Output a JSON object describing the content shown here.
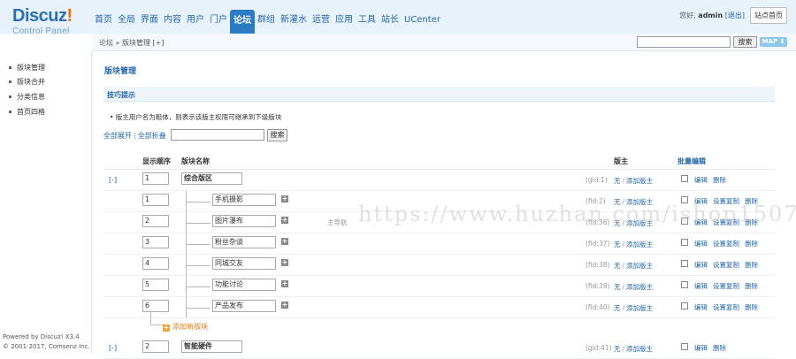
{
  "header": {
    "logo_title": "Discuz",
    "logo_bang": "!",
    "logo_sub": "Control Panel",
    "nav": [
      "首页",
      "全局",
      "界面",
      "内容",
      "用户",
      "门户",
      "论坛",
      "群组",
      "新灌水",
      "运营",
      "应用",
      "工具",
      "站长",
      "UCenter"
    ],
    "active_nav": "论坛",
    "greeting": "您好, ",
    "username": "admin",
    "logout": "[退出]",
    "site_home": "站点首页"
  },
  "subbar": {
    "breadcrumb": "论坛 » 版块管理  [+]",
    "search_button": "搜索",
    "map_button": "MAP ⬇"
  },
  "sidebar": {
    "items": [
      "版块管理",
      "版块合并",
      "分类信息",
      "首页四格"
    ],
    "powered_line1": "Powered by Discuz! X3.4",
    "powered_line2": "© 2001-2017, Comsenz Inc."
  },
  "main": {
    "page_title": "版块管理",
    "tips_title": "技巧提示",
    "tip_text": "•  版主用户名为粗体，则表示该版主权限可继承到下级版块",
    "expand_all": "全部展开",
    "collapse_all": "全部折叠",
    "search_button": "搜索",
    "headers": {
      "order": "显示顺序",
      "name": "版块名称",
      "moderator": "版主",
      "batch_edit": "批量编辑"
    },
    "groups": [
      {
        "toggle": "[-]",
        "order": "1",
        "name": "综合版区",
        "fid": "(gid:1)",
        "mod_none": "无",
        "mod_add": "添加版主",
        "ops": [
          "编辑",
          "删除"
        ]
      },
      {
        "toggle": "[-]",
        "order": "2",
        "name": "智能硬件",
        "fid": "(gid:41)",
        "mod_none": "无",
        "mod_add": "添加版主",
        "ops": [
          "编辑",
          "删除"
        ]
      }
    ],
    "forums": [
      {
        "order": "1",
        "name": "手机摄影",
        "fid": "(fid:2)",
        "mod_none": "无",
        "mod_add": "添加版主",
        "ops": [
          "编辑",
          "设置复制",
          "删除"
        ]
      },
      {
        "order": "2",
        "name": "图片瀑布",
        "fid": "(fid:36)",
        "mod_none": "无",
        "mod_add": "添加版主",
        "ops": [
          "编辑",
          "设置复制",
          "删除"
        ]
      },
      {
        "order": "3",
        "name": "粉丝杂谈",
        "fid": "(fid:37)",
        "mod_none": "无",
        "mod_add": "添加版主",
        "ops": [
          "编辑",
          "设置复制",
          "删除"
        ]
      },
      {
        "order": "4",
        "name": "同城交友",
        "fid": "(fid:38)",
        "mod_none": "无",
        "mod_add": "添加版主",
        "ops": [
          "编辑",
          "设置复制",
          "删除"
        ]
      },
      {
        "order": "5",
        "name": "功能讨论",
        "fid": "(fid:39)",
        "mod_none": "无",
        "mod_add": "添加版主",
        "ops": [
          "编辑",
          "设置复制",
          "删除"
        ]
      },
      {
        "order": "6",
        "name": "产品发布",
        "fid": "(fid:40)",
        "mod_none": "无",
        "mod_add": "添加版主",
        "ops": [
          "编辑",
          "设置复制",
          "删除"
        ]
      }
    ],
    "add_forum": "添加新版块",
    "main_nav_label": "主导航"
  },
  "watermark": "https://www.huzhan.com/ishop15079",
  "colors": {
    "accent": "#2b7cc4",
    "link": "#2366a8",
    "header_bg": "#e8f2fb",
    "add_orange": "#e07a10"
  }
}
